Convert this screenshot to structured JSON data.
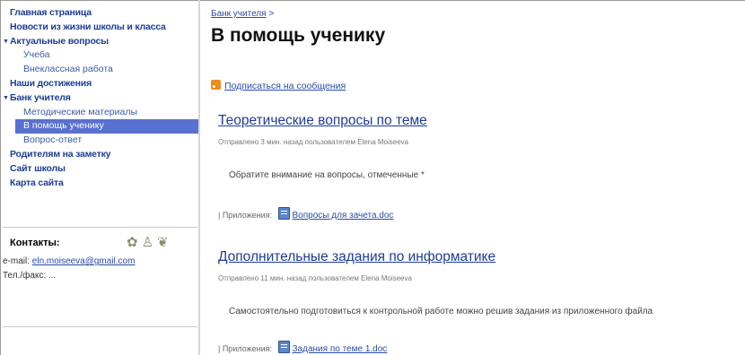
{
  "sidebar": {
    "items": [
      {
        "label": "Главная страница"
      },
      {
        "label": "Новости из жизни школы и класса"
      },
      {
        "label": "Актуальные вопросы"
      },
      {
        "label": "Учеба"
      },
      {
        "label": "Внеклассная работа"
      },
      {
        "label": "Наши достижения"
      },
      {
        "label": "Банк учителя"
      },
      {
        "label": "Методические материалы"
      },
      {
        "label": "В помощь ученику"
      },
      {
        "label": "Вопрос-ответ"
      },
      {
        "label": "Родителям на заметку"
      },
      {
        "label": "Сайт школы"
      },
      {
        "label": "Карта сайта"
      }
    ],
    "contacts_title": "Контакты:",
    "email_prefix": "e-mail:",
    "email": "eln.moiseeva@gmail.com",
    "phone": "Тел./факс: ...",
    "icons": [
      "ribbon-icon",
      "figure-icon",
      "award-icon"
    ]
  },
  "breadcrumb": {
    "link": "Банк учителя",
    "separator": " >"
  },
  "page_title": "В помощь ученику",
  "subscribe": {
    "label": "Подписаться на сообщения"
  },
  "posts": [
    {
      "title": "Теоретические вопросы по теме",
      "meta": "Отправлено 3 мин. назад пользователем Elena Moiseeva",
      "body": "Обратите внимание на вопросы, отмеченные *",
      "attach_label": "| Приложения:",
      "attach_file": "Вопросы для зачета.doc"
    },
    {
      "title": "Дополнительные задания по информатике",
      "meta": "Отправлено 11 мин. назад пользователем Elena Moiseeva",
      "body": "Самостоятельно подготовиться к контрольной работе можно решив задания из приложенного файла",
      "attach_label": "| Приложения:",
      "attach_file": "Задания по теме 1.doc"
    }
  ],
  "colors": {
    "link": "#2a4ba8",
    "nav_bold": "#1d3d96",
    "selected_bg": "#5871d0",
    "rss": "#f08a1c"
  }
}
